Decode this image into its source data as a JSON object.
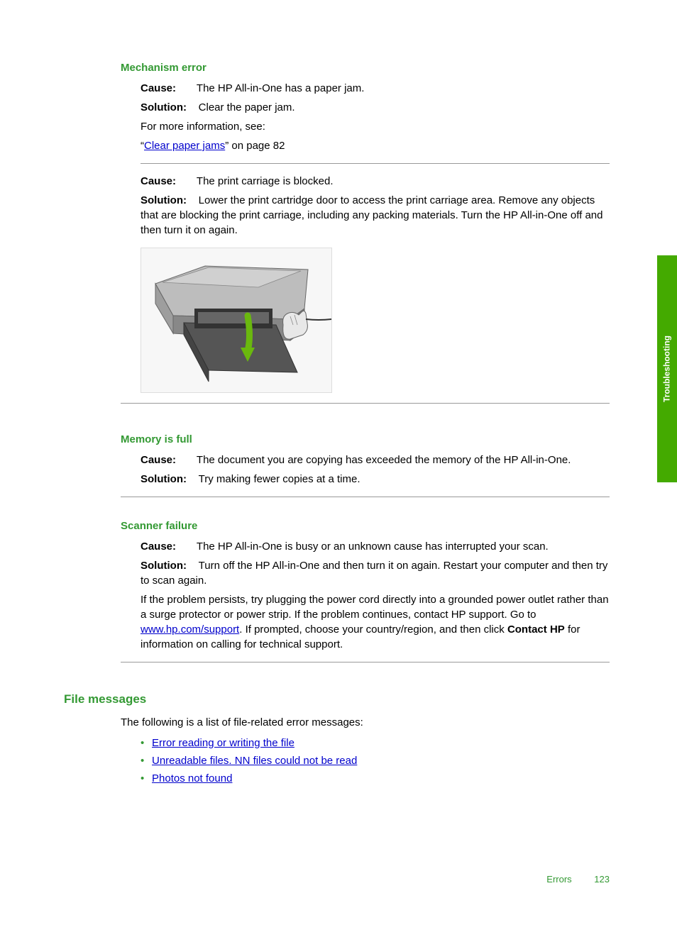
{
  "sideTab": "Troubleshooting",
  "footer": {
    "label": "Errors",
    "page": "123"
  },
  "sections": {
    "mechanism": {
      "heading": "Mechanism error",
      "cause1Label": "Cause:",
      "cause1Text": "The HP All-in-One has a paper jam.",
      "solution1Label": "Solution:",
      "solution1Text": "Clear the paper jam.",
      "moreInfo": "For more information, see:",
      "linkPrefix": "“",
      "linkText": "Clear paper jams",
      "linkSuffix": "” on page 82",
      "cause2Label": "Cause:",
      "cause2Text": "The print carriage is blocked.",
      "solution2Label": "Solution:",
      "solution2Text": "Lower the print cartridge door to access the print carriage area. Remove any objects that are blocking the print carriage, including any packing materials. Turn the HP All-in-One off and then turn it on again."
    },
    "memory": {
      "heading": "Memory is full",
      "causeLabel": "Cause:",
      "causeText": "The document you are copying has exceeded the memory of the HP All-in-One.",
      "solutionLabel": "Solution:",
      "solutionText": "Try making fewer copies at a time."
    },
    "scanner": {
      "heading": "Scanner failure",
      "causeLabel": "Cause:",
      "causeText": "The HP All-in-One is busy or an unknown cause has interrupted your scan.",
      "solutionLabel": "Solution:",
      "solutionText": "Turn off the HP All-in-One and then turn it on again. Restart your computer and then try to scan again.",
      "persistPrefix": "If the problem persists, try plugging the power cord directly into a grounded power outlet rather than a surge protector or power strip. If the problem continues, contact HP support. Go to ",
      "persistLink": "www.hp.com/support",
      "persistMid": ". If prompted, choose your country/region, and then click ",
      "persistBold": "Contact HP",
      "persistSuffix": " for information on calling for technical support."
    },
    "file": {
      "heading": "File messages",
      "intro": "The following is a list of file-related error messages:",
      "items": [
        "Error reading or writing the file",
        "Unreadable files. NN files could not be read",
        "Photos not found"
      ]
    }
  }
}
